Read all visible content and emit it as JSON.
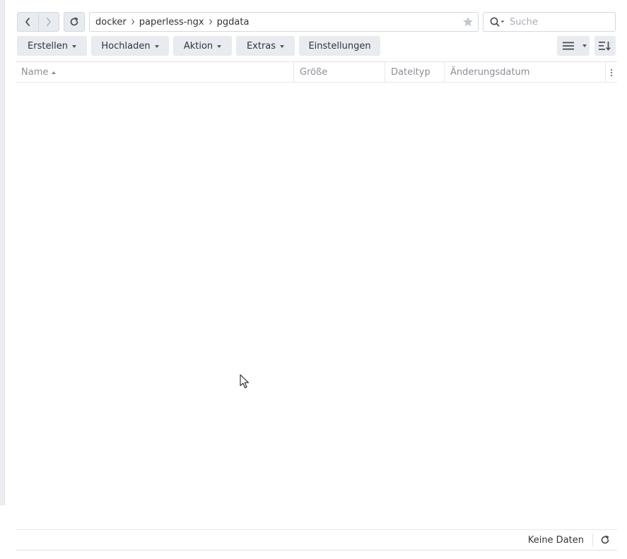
{
  "breadcrumb": [
    "docker",
    "paperless-ngx",
    "pgdata"
  ],
  "search": {
    "placeholder": "Suche"
  },
  "toolbar": {
    "create_label": "Erstellen",
    "upload_label": "Hochladen",
    "action_label": "Aktion",
    "extras_label": "Extras",
    "settings_label": "Einstellungen"
  },
  "table": {
    "columns": {
      "name": "Name",
      "size": "Größe",
      "type": "Dateityp",
      "modified": "Änderungsdatum"
    },
    "rows": []
  },
  "status": {
    "text": "Keine Daten"
  },
  "icons": {
    "back": "chevron-left-icon",
    "forward": "chevron-right-icon",
    "refresh": "refresh-icon",
    "favorite": "star-icon",
    "search": "search-icon",
    "view": "list-view-icon",
    "sort": "sort-icon",
    "column_menu": "more-vertical-icon"
  },
  "colors": {
    "button_bg": "#e8ebef",
    "border": "#d4d8dd",
    "muted_text": "#8a8f96"
  }
}
